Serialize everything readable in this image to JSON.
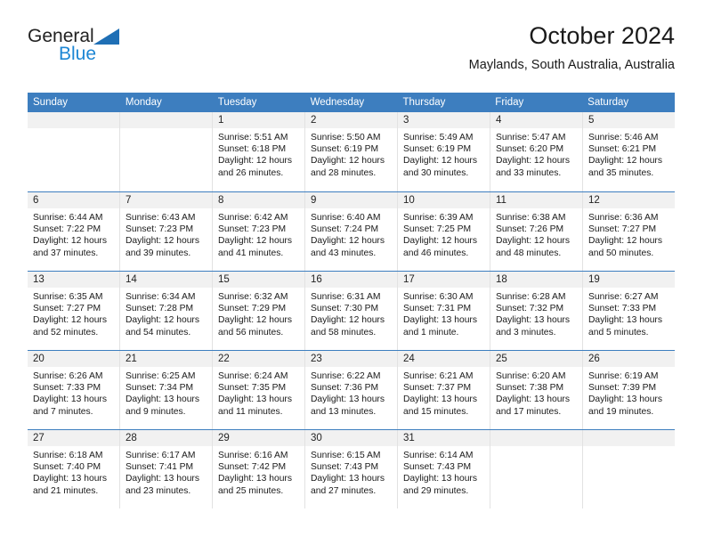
{
  "brand": {
    "line1": "General",
    "line2": "Blue",
    "triangle_color": "#1F6FB5",
    "blue_text_color": "#1C86D4"
  },
  "header": {
    "title": "October 2024",
    "subtitle": "Maylands, South Australia, Australia"
  },
  "theme": {
    "header_row_bg": "#3D7EBF",
    "week_divider": "#3D7EBF",
    "daynum_band_bg": "#F1F1F1",
    "column_divider": "#E2E2E2"
  },
  "weekdays": [
    "Sunday",
    "Monday",
    "Tuesday",
    "Wednesday",
    "Thursday",
    "Friday",
    "Saturday"
  ],
  "weeks": [
    [
      {
        "day": "",
        "lines": []
      },
      {
        "day": "",
        "lines": []
      },
      {
        "day": "1",
        "lines": [
          "Sunrise: 5:51 AM",
          "Sunset: 6:18 PM",
          "Daylight: 12 hours",
          "and 26 minutes."
        ]
      },
      {
        "day": "2",
        "lines": [
          "Sunrise: 5:50 AM",
          "Sunset: 6:19 PM",
          "Daylight: 12 hours",
          "and 28 minutes."
        ]
      },
      {
        "day": "3",
        "lines": [
          "Sunrise: 5:49 AM",
          "Sunset: 6:19 PM",
          "Daylight: 12 hours",
          "and 30 minutes."
        ]
      },
      {
        "day": "4",
        "lines": [
          "Sunrise: 5:47 AM",
          "Sunset: 6:20 PM",
          "Daylight: 12 hours",
          "and 33 minutes."
        ]
      },
      {
        "day": "5",
        "lines": [
          "Sunrise: 5:46 AM",
          "Sunset: 6:21 PM",
          "Daylight: 12 hours",
          "and 35 minutes."
        ]
      }
    ],
    [
      {
        "day": "6",
        "lines": [
          "Sunrise: 6:44 AM",
          "Sunset: 7:22 PM",
          "Daylight: 12 hours",
          "and 37 minutes."
        ]
      },
      {
        "day": "7",
        "lines": [
          "Sunrise: 6:43 AM",
          "Sunset: 7:23 PM",
          "Daylight: 12 hours",
          "and 39 minutes."
        ]
      },
      {
        "day": "8",
        "lines": [
          "Sunrise: 6:42 AM",
          "Sunset: 7:23 PM",
          "Daylight: 12 hours",
          "and 41 minutes."
        ]
      },
      {
        "day": "9",
        "lines": [
          "Sunrise: 6:40 AM",
          "Sunset: 7:24 PM",
          "Daylight: 12 hours",
          "and 43 minutes."
        ]
      },
      {
        "day": "10",
        "lines": [
          "Sunrise: 6:39 AM",
          "Sunset: 7:25 PM",
          "Daylight: 12 hours",
          "and 46 minutes."
        ]
      },
      {
        "day": "11",
        "lines": [
          "Sunrise: 6:38 AM",
          "Sunset: 7:26 PM",
          "Daylight: 12 hours",
          "and 48 minutes."
        ]
      },
      {
        "day": "12",
        "lines": [
          "Sunrise: 6:36 AM",
          "Sunset: 7:27 PM",
          "Daylight: 12 hours",
          "and 50 minutes."
        ]
      }
    ],
    [
      {
        "day": "13",
        "lines": [
          "Sunrise: 6:35 AM",
          "Sunset: 7:27 PM",
          "Daylight: 12 hours",
          "and 52 minutes."
        ]
      },
      {
        "day": "14",
        "lines": [
          "Sunrise: 6:34 AM",
          "Sunset: 7:28 PM",
          "Daylight: 12 hours",
          "and 54 minutes."
        ]
      },
      {
        "day": "15",
        "lines": [
          "Sunrise: 6:32 AM",
          "Sunset: 7:29 PM",
          "Daylight: 12 hours",
          "and 56 minutes."
        ]
      },
      {
        "day": "16",
        "lines": [
          "Sunrise: 6:31 AM",
          "Sunset: 7:30 PM",
          "Daylight: 12 hours",
          "and 58 minutes."
        ]
      },
      {
        "day": "17",
        "lines": [
          "Sunrise: 6:30 AM",
          "Sunset: 7:31 PM",
          "Daylight: 13 hours",
          "and 1 minute."
        ]
      },
      {
        "day": "18",
        "lines": [
          "Sunrise: 6:28 AM",
          "Sunset: 7:32 PM",
          "Daylight: 13 hours",
          "and 3 minutes."
        ]
      },
      {
        "day": "19",
        "lines": [
          "Sunrise: 6:27 AM",
          "Sunset: 7:33 PM",
          "Daylight: 13 hours",
          "and 5 minutes."
        ]
      }
    ],
    [
      {
        "day": "20",
        "lines": [
          "Sunrise: 6:26 AM",
          "Sunset: 7:33 PM",
          "Daylight: 13 hours",
          "and 7 minutes."
        ]
      },
      {
        "day": "21",
        "lines": [
          "Sunrise: 6:25 AM",
          "Sunset: 7:34 PM",
          "Daylight: 13 hours",
          "and 9 minutes."
        ]
      },
      {
        "day": "22",
        "lines": [
          "Sunrise: 6:24 AM",
          "Sunset: 7:35 PM",
          "Daylight: 13 hours",
          "and 11 minutes."
        ]
      },
      {
        "day": "23",
        "lines": [
          "Sunrise: 6:22 AM",
          "Sunset: 7:36 PM",
          "Daylight: 13 hours",
          "and 13 minutes."
        ]
      },
      {
        "day": "24",
        "lines": [
          "Sunrise: 6:21 AM",
          "Sunset: 7:37 PM",
          "Daylight: 13 hours",
          "and 15 minutes."
        ]
      },
      {
        "day": "25",
        "lines": [
          "Sunrise: 6:20 AM",
          "Sunset: 7:38 PM",
          "Daylight: 13 hours",
          "and 17 minutes."
        ]
      },
      {
        "day": "26",
        "lines": [
          "Sunrise: 6:19 AM",
          "Sunset: 7:39 PM",
          "Daylight: 13 hours",
          "and 19 minutes."
        ]
      }
    ],
    [
      {
        "day": "27",
        "lines": [
          "Sunrise: 6:18 AM",
          "Sunset: 7:40 PM",
          "Daylight: 13 hours",
          "and 21 minutes."
        ]
      },
      {
        "day": "28",
        "lines": [
          "Sunrise: 6:17 AM",
          "Sunset: 7:41 PM",
          "Daylight: 13 hours",
          "and 23 minutes."
        ]
      },
      {
        "day": "29",
        "lines": [
          "Sunrise: 6:16 AM",
          "Sunset: 7:42 PM",
          "Daylight: 13 hours",
          "and 25 minutes."
        ]
      },
      {
        "day": "30",
        "lines": [
          "Sunrise: 6:15 AM",
          "Sunset: 7:43 PM",
          "Daylight: 13 hours",
          "and 27 minutes."
        ]
      },
      {
        "day": "31",
        "lines": [
          "Sunrise: 6:14 AM",
          "Sunset: 7:43 PM",
          "Daylight: 13 hours",
          "and 29 minutes."
        ]
      },
      {
        "day": "",
        "lines": []
      },
      {
        "day": "",
        "lines": []
      }
    ]
  ]
}
